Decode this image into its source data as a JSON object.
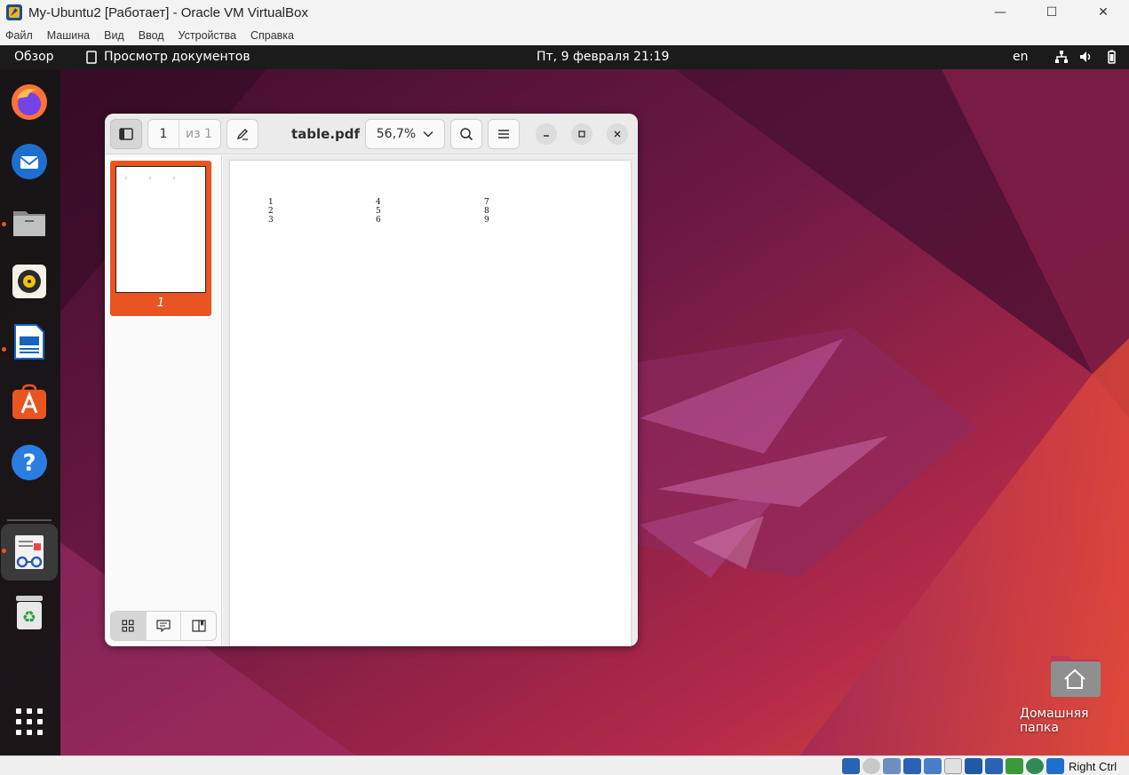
{
  "vbox": {
    "title": "My-Ubuntu2 [Работает] - Oracle VM VirtualBox",
    "menu": [
      "Файл",
      "Машина",
      "Вид",
      "Ввод",
      "Устройства",
      "Справка"
    ],
    "window_controls": [
      "—",
      "☐",
      "✕"
    ],
    "host_key": "Right Ctrl"
  },
  "topbar": {
    "activities": "Обзор",
    "app_name": "Просмотр документов",
    "clock": "Пт, 9 февраля  21:19",
    "lang": "en"
  },
  "dock": {
    "items": [
      {
        "name": "firefox-icon",
        "running": false
      },
      {
        "name": "thunderbird-icon",
        "running": false
      },
      {
        "name": "files-icon",
        "running": true
      },
      {
        "name": "rhythmbox-icon",
        "running": false
      },
      {
        "name": "libreoffice-writer-icon",
        "running": true
      },
      {
        "name": "app-center-icon",
        "running": false
      },
      {
        "name": "help-icon",
        "running": false
      },
      {
        "name": "document-viewer-icon",
        "running": true
      },
      {
        "name": "trash-icon",
        "running": false
      },
      {
        "name": "show-apps-icon",
        "running": false
      }
    ]
  },
  "viewer": {
    "page_current": "1",
    "page_total": "из 1",
    "filename": "table.pdf",
    "zoom": "56,7%",
    "thumbnail_label": "1",
    "table": [
      [
        "1",
        "4",
        "7"
      ],
      [
        "2",
        "5",
        "8"
      ],
      [
        "3",
        "6",
        "9"
      ]
    ]
  },
  "desktop": {
    "home_folder_label": "Домашняя папка"
  },
  "colors": {
    "accent": "#e95420",
    "topbar": "#1b1b1b",
    "dock": "#161616"
  }
}
